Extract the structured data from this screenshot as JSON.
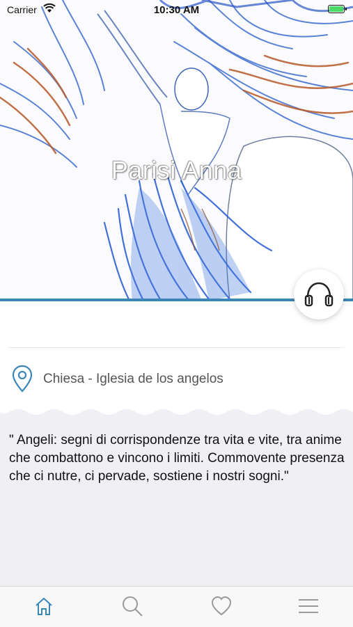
{
  "status_bar": {
    "carrier": "Carrier",
    "time": "10:30 AM"
  },
  "hero": {
    "title": "Parisi Anna"
  },
  "location": {
    "text": "Chiesa - Iglesia de los angelos"
  },
  "description": {
    "quote": "\" Angeli: segni di corrispondenze tra vita e vite, tra anime che combattono e vincono i limiti. Commovente presenza che ci nutre, ci pervade, sostiene i nostri sogni.\""
  },
  "tabbar": {
    "items": [
      "home-icon",
      "search-icon",
      "heart-icon",
      "menu-icon"
    ],
    "active": "home-icon"
  },
  "colors": {
    "accent": "#3b86b8",
    "battery": "#4cd964",
    "background_grey": "#efeff4"
  }
}
